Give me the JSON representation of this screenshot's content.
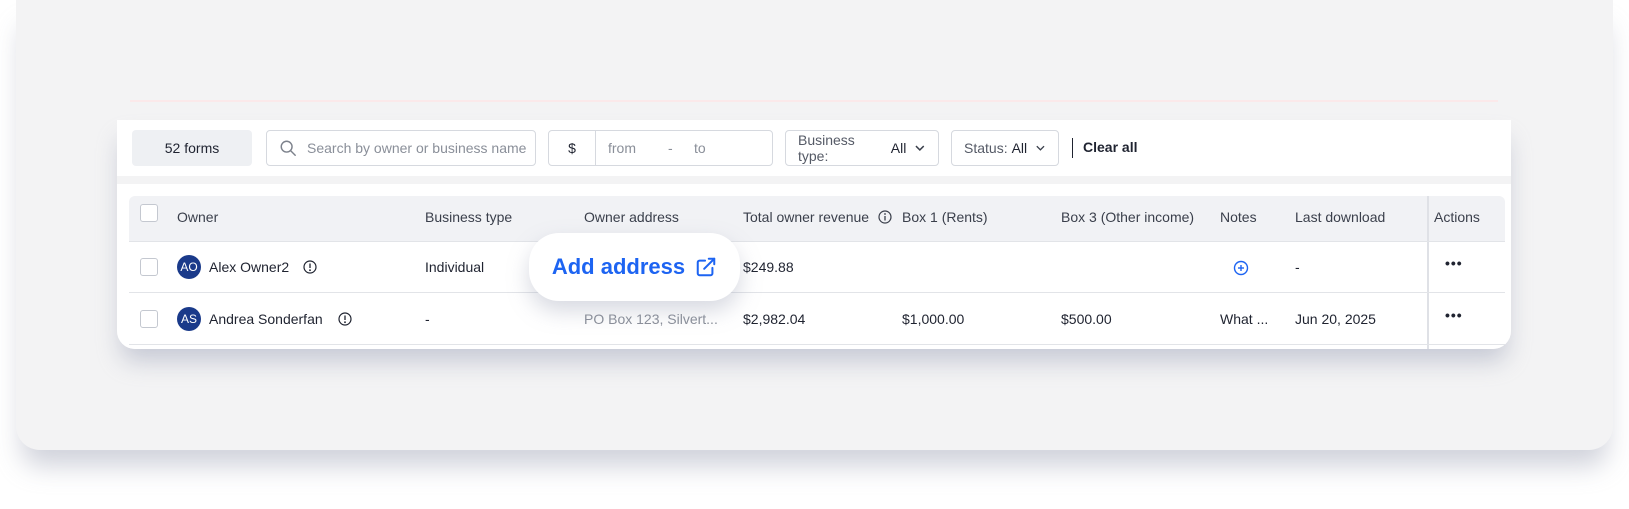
{
  "filters": {
    "forms_count": "52 forms",
    "search_placeholder": "Search by owner or business name",
    "currency_symbol": "$",
    "range_from_placeholder": "from",
    "range_separator": "-",
    "range_to_placeholder": "to",
    "business_type_label": "Business type:",
    "business_type_value": "All",
    "status_label": "Status:",
    "status_value": "All",
    "clear_all": "Clear all"
  },
  "table": {
    "columns": [
      "Owner",
      "Business type",
      "Owner address",
      "Total owner revenue",
      "Box 1 (Rents)",
      "Box 3 (Other income)",
      "Notes",
      "Last download",
      "Actions"
    ],
    "rows": [
      {
        "initials": "AO",
        "owner": "Alex Owner2",
        "business_type": "Individual",
        "owner_address": "",
        "total_revenue": "$249.88",
        "box1": "",
        "box3": "",
        "notes": "",
        "last_download": "-",
        "actions": "•••"
      },
      {
        "initials": "AS",
        "owner": "Andrea Sonderfan",
        "business_type": "-",
        "owner_address": "PO Box 123, Silvert...",
        "total_revenue": "$2,982.04",
        "box1": "$1,000.00",
        "box3": "$500.00",
        "notes": "What ...",
        "last_download": "Jun 20, 2025",
        "actions": "•••"
      }
    ]
  },
  "tooltip": {
    "label": "Add address"
  },
  "icons": {
    "search": "search-icon",
    "chevron": "chevron-down-icon",
    "info": "info-icon",
    "add_note": "plus-circle-icon",
    "external": "external-link-icon",
    "more": "more-horizontal-icon"
  },
  "colors": {
    "accent": "#1d64f2",
    "avatar": "#1a3a8a",
    "background": "#f3f3f4"
  }
}
